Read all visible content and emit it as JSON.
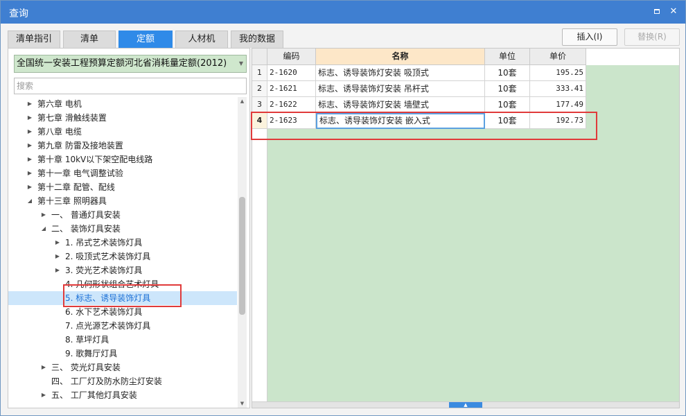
{
  "window": {
    "title": "查询"
  },
  "tabs": [
    {
      "label": "清单指引",
      "active": false
    },
    {
      "label": "清单",
      "active": false
    },
    {
      "label": "定额",
      "active": true
    },
    {
      "label": "人材机",
      "active": false
    },
    {
      "label": "我的数据",
      "active": false
    }
  ],
  "buttons": {
    "insert": "插入(I)",
    "replace": "替换(R)"
  },
  "quota_db": {
    "selected": "全国统一安装工程预算定额河北省消耗量定额(2012)"
  },
  "search": {
    "placeholder": "搜索"
  },
  "tree": [
    {
      "label": "第六章 电机",
      "level": 0,
      "expanded": false
    },
    {
      "label": "第七章 滑触线装置",
      "level": 0,
      "expanded": false
    },
    {
      "label": "第八章 电缆",
      "level": 0,
      "expanded": false
    },
    {
      "label": "第九章 防雷及接地装置",
      "level": 0,
      "expanded": false
    },
    {
      "label": "第十章 10kV以下架空配电线路",
      "level": 0,
      "expanded": false
    },
    {
      "label": "第十一章 电气调整试验",
      "level": 0,
      "expanded": false
    },
    {
      "label": "第十二章 配管、配线",
      "level": 0,
      "expanded": false
    },
    {
      "label": "第十三章 照明器具",
      "level": 0,
      "expanded": true
    },
    {
      "label": "一、 普通灯具安装",
      "level": 1,
      "expanded": false
    },
    {
      "label": "二、 装饰灯具安装",
      "level": 1,
      "expanded": true
    },
    {
      "label": "1. 吊式艺术装饰灯具",
      "level": 2,
      "expanded": false
    },
    {
      "label": "2. 吸顶式艺术装饰灯具",
      "level": 2,
      "expanded": false
    },
    {
      "label": "3. 荧光艺术装饰灯具",
      "level": 2,
      "expanded": false
    },
    {
      "label": "4. 几何形状组合艺术灯具",
      "level": 2,
      "leaf": true
    },
    {
      "label": "5. 标志、诱导装饰灯具",
      "level": 2,
      "leaf": true,
      "selected": true
    },
    {
      "label": "6. 水下艺术装饰灯具",
      "level": 2,
      "leaf": true
    },
    {
      "label": "7. 点光源艺术装饰灯具",
      "level": 2,
      "leaf": true
    },
    {
      "label": "8. 草坪灯具",
      "level": 2,
      "leaf": true
    },
    {
      "label": "9. 歌舞厅灯具",
      "level": 2,
      "leaf": true
    },
    {
      "label": "三、 荧光灯具安装",
      "level": 1,
      "expanded": false
    },
    {
      "label": "四、 工厂灯及防水防尘灯安装",
      "level": 1,
      "leaf": true
    },
    {
      "label": "五、 工厂其他灯具安装",
      "level": 1,
      "expanded": false
    }
  ],
  "grid": {
    "headers": {
      "code": "编码",
      "name": "名称",
      "unit": "单位",
      "price": "单价"
    },
    "rows": [
      {
        "num": "1",
        "code": "2-1620",
        "name": "标志、诱导装饰灯安装 吸顶式",
        "unit": "10套",
        "price": "195.25"
      },
      {
        "num": "2",
        "code": "2-1621",
        "name": "标志、诱导装饰灯安装 吊杆式",
        "unit": "10套",
        "price": "333.41"
      },
      {
        "num": "3",
        "code": "2-1622",
        "name": "标志、诱导装饰灯安装 墙壁式",
        "unit": "10套",
        "price": "177.49"
      },
      {
        "num": "4",
        "code": "2-1623",
        "name": "标志、诱导装饰灯安装 嵌入式",
        "unit": "10套",
        "price": "192.73",
        "active": true
      }
    ]
  },
  "colors": {
    "titlebar": "#3f7fd1",
    "active_tab": "#2f8ae8",
    "grid_bg": "#cbe5cb",
    "highlight": "#e03a3a"
  },
  "icons": {
    "restore": "restore-icon",
    "close": "close-icon"
  }
}
